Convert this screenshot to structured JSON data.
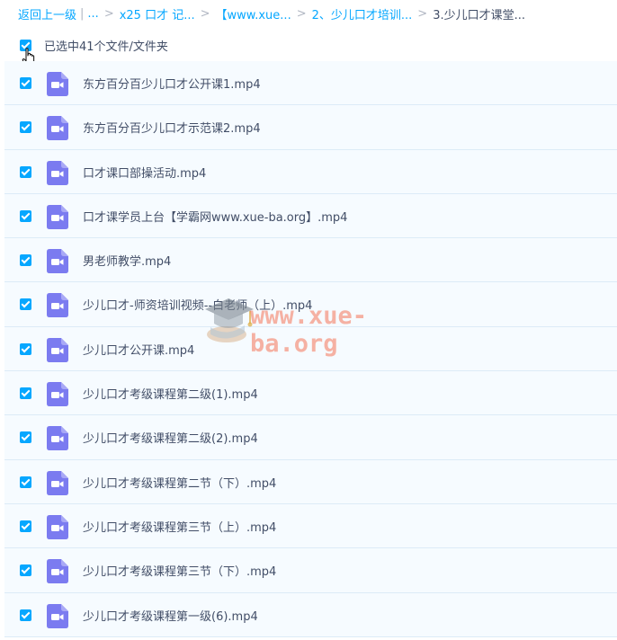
{
  "breadcrumb": {
    "back": "返回上一级",
    "ellipsis": "...",
    "items": [
      "x25 口才 记...",
      "【www.xue...",
      "2、少儿口才培训...",
      "3.少儿口才课堂..."
    ],
    "separator": ">",
    "pipe": "|"
  },
  "selection": {
    "label": "已选中41个文件/文件夹"
  },
  "files": [
    {
      "name": "东方百分百少儿口才公开课1.mp4"
    },
    {
      "name": "东方百分百少儿口才示范课2.mp4"
    },
    {
      "name": "口才课口部操活动.mp4"
    },
    {
      "name": "口才课学员上台【学霸网www.xue-ba.org】.mp4"
    },
    {
      "name": "男老师教学.mp4"
    },
    {
      "name": "少儿口才-师资培训视频--白老师（上）.mp4"
    },
    {
      "name": "少儿口才公开课.mp4"
    },
    {
      "name": "少儿口才考级课程第二级(1).mp4"
    },
    {
      "name": "少儿口才考级课程第二级(2).mp4"
    },
    {
      "name": "少儿口才考级课程第二节（下）.mp4"
    },
    {
      "name": "少儿口才考级课程第三节（上）.mp4"
    },
    {
      "name": "少儿口才考级课程第三节（下）.mp4"
    },
    {
      "name": "少儿口才考级课程第一级(6).mp4"
    }
  ],
  "watermark": {
    "text": "www.xue-ba.org"
  },
  "icons": {
    "file": "video-file-icon",
    "check": "checkbox-checked-icon",
    "cursor": "hand-pointer-icon"
  },
  "colors": {
    "accent": "#06a7ff",
    "video_icon": "#7b7bf0",
    "row_bg": "#f6fbff",
    "watermark": "#f47458"
  }
}
